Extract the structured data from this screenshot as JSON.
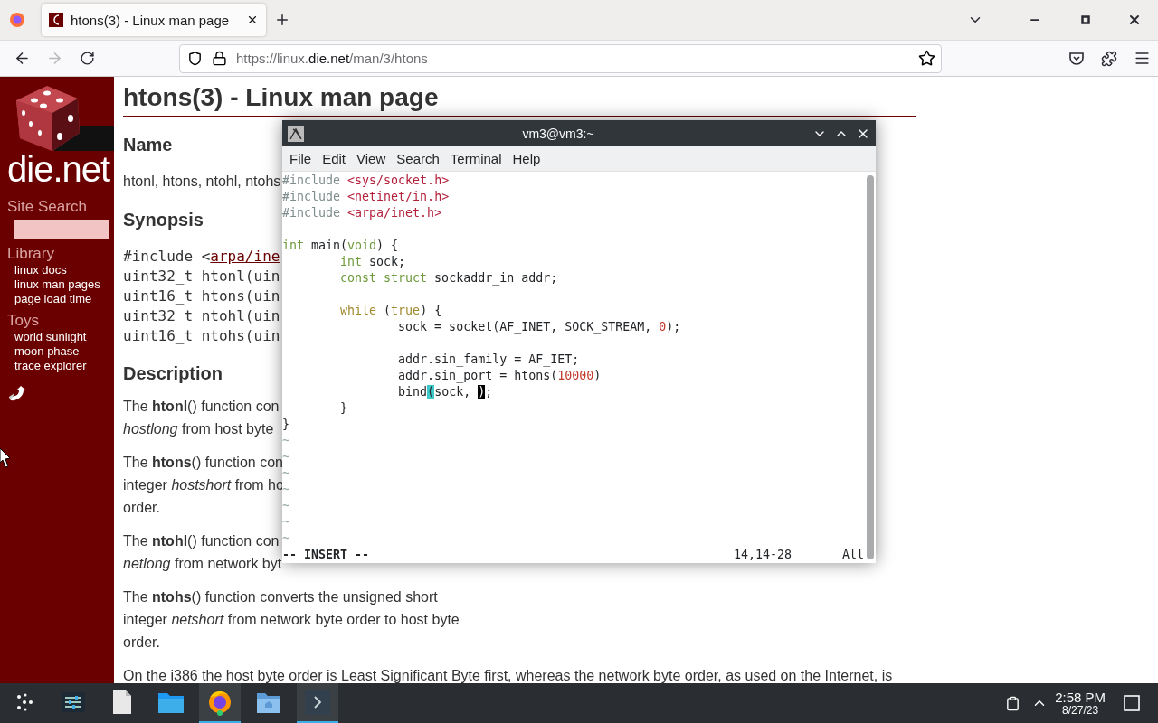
{
  "browser": {
    "tabs": [
      {
        "title": "htons(3) - Linux man page",
        "selected": true
      }
    ],
    "url": {
      "host_start": "https://linux.",
      "domain": "die.net",
      "path": "/man/3/htons"
    },
    "forward_disabled": true
  },
  "sidebar": {
    "logo_text": "die.net",
    "search_label": "Site Search",
    "sections": [
      {
        "title": "Library",
        "links": [
          "linux docs",
          "linux man pages",
          "page load time"
        ]
      },
      {
        "title": "Toys",
        "links": [
          "world sunlight",
          "moon phase",
          "trace explorer"
        ]
      }
    ]
  },
  "page": {
    "title": "htons(3) - Linux man page",
    "name_heading": "Name",
    "name_text": "htonl, htons, ntohl, ntohs",
    "synopsis_heading": "Synopsis",
    "synopsis": [
      {
        "text": "#include <",
        "link": "arpa/ine"
      },
      {
        "text": "uint32_t htonl(uin"
      },
      {
        "text": "uint16_t htons(uin"
      },
      {
        "text": "uint32_t ntohl(uin"
      },
      {
        "text": "uint16_t ntohs(uin"
      }
    ],
    "description_heading": "Description",
    "paragraphs": [
      {
        "lines": [
          "The **htonl**() function con",
          "*hostlong* from host byte"
        ]
      },
      {
        "lines": [
          "The **htons**() function con",
          "integer *hostshort* from ho",
          "order."
        ]
      },
      {
        "lines": [
          "The **ntohl**() function con",
          "*netlong* from network byt"
        ]
      },
      {
        "lines": [
          "The **ntohs**() function converts the unsigned short",
          "integer *netshort* from network byte order to host byte",
          "order."
        ]
      },
      {
        "lines": [
          "On the i386 the host byte order is Least Significant Byte first, whereas the network byte order, as used on the Internet, is"
        ]
      }
    ]
  },
  "terminal": {
    "title": "vm3@vm3:~",
    "menu": [
      "File",
      "Edit",
      "View",
      "Search",
      "Terminal",
      "Help"
    ],
    "lines": [
      {
        "kind": "code",
        "segments": [
          {
            "kind": "preproc",
            "text": "#include "
          },
          {
            "kind": "string",
            "text": "<sys/socket.h>"
          }
        ]
      },
      {
        "kind": "code",
        "segments": [
          {
            "kind": "preproc",
            "text": "#include "
          },
          {
            "kind": "string",
            "text": "<netinet/in.h>"
          }
        ]
      },
      {
        "kind": "code",
        "segments": [
          {
            "kind": "preproc",
            "text": "#include "
          },
          {
            "kind": "string",
            "text": "<arpa/inet.h>"
          }
        ]
      },
      {
        "kind": "blank"
      },
      {
        "kind": "code",
        "segments": [
          {
            "kind": "type",
            "text": "int"
          },
          {
            "kind": "plain",
            "text": " main("
          },
          {
            "kind": "type",
            "text": "void"
          },
          {
            "kind": "plain",
            "text": ") {"
          }
        ]
      },
      {
        "kind": "code",
        "segments": [
          {
            "kind": "type",
            "text": "        int"
          },
          {
            "kind": "plain",
            "text": " sock;"
          }
        ]
      },
      {
        "kind": "code",
        "segments": [
          {
            "kind": "type",
            "text": "        const struct"
          },
          {
            "kind": "plain",
            "text": " sockaddr_in addr;"
          }
        ]
      },
      {
        "kind": "blank"
      },
      {
        "kind": "code",
        "segments": [
          {
            "kind": "statement",
            "text": "        while"
          },
          {
            "kind": "plain",
            "text": " ("
          },
          {
            "kind": "statement",
            "text": "true"
          },
          {
            "kind": "plain",
            "text": ") {"
          }
        ]
      },
      {
        "kind": "code",
        "segments": [
          {
            "kind": "plain",
            "text": "                sock = socket(AF_INET, SOCK_STREAM, "
          },
          {
            "kind": "number",
            "text": "0"
          },
          {
            "kind": "plain",
            "text": ");"
          }
        ]
      },
      {
        "kind": "blank"
      },
      {
        "kind": "code",
        "segments": [
          {
            "kind": "plain",
            "text": "                addr.sin_family = AF_IET;"
          }
        ]
      },
      {
        "kind": "code",
        "segments": [
          {
            "kind": "plain",
            "text": "                addr.sin_port = htons("
          },
          {
            "kind": "number",
            "text": "10000"
          },
          {
            "kind": "plain",
            "text": ")"
          }
        ]
      },
      {
        "kind": "code",
        "segments": [
          {
            "kind": "plain",
            "text": "                bind"
          },
          {
            "kind": "match",
            "text": "("
          },
          {
            "kind": "plain",
            "text": "sock, "
          },
          {
            "kind": "cursor",
            "text": ")"
          },
          {
            "kind": "plain",
            "text": ";"
          }
        ]
      },
      {
        "kind": "code",
        "segments": [
          {
            "kind": "plain",
            "text": "        }"
          }
        ]
      },
      {
        "kind": "code",
        "segments": [
          {
            "kind": "plain",
            "text": "}"
          }
        ]
      },
      {
        "kind": "tilde",
        "text": "~"
      },
      {
        "kind": "tilde",
        "text": "~"
      },
      {
        "kind": "tilde",
        "text": "~"
      },
      {
        "kind": "tilde",
        "text": "~"
      },
      {
        "kind": "tilde",
        "text": "~"
      },
      {
        "kind": "tilde",
        "text": "~"
      },
      {
        "kind": "tilde",
        "text": "~"
      }
    ],
    "mode": "-- INSERT --",
    "position": "14,14-28",
    "scroll": "All"
  },
  "taskbar": {
    "items": [
      {
        "kind": "launcher",
        "active": false
      },
      {
        "kind": "mixer",
        "active": false
      },
      {
        "kind": "document",
        "active": false
      },
      {
        "kind": "folder",
        "active": false
      },
      {
        "kind": "firefox",
        "active": true
      },
      {
        "kind": "home-folder",
        "active": false
      },
      {
        "kind": "terminal",
        "active": true
      }
    ],
    "time": "2:58 PM",
    "date": "8/27/23"
  }
}
